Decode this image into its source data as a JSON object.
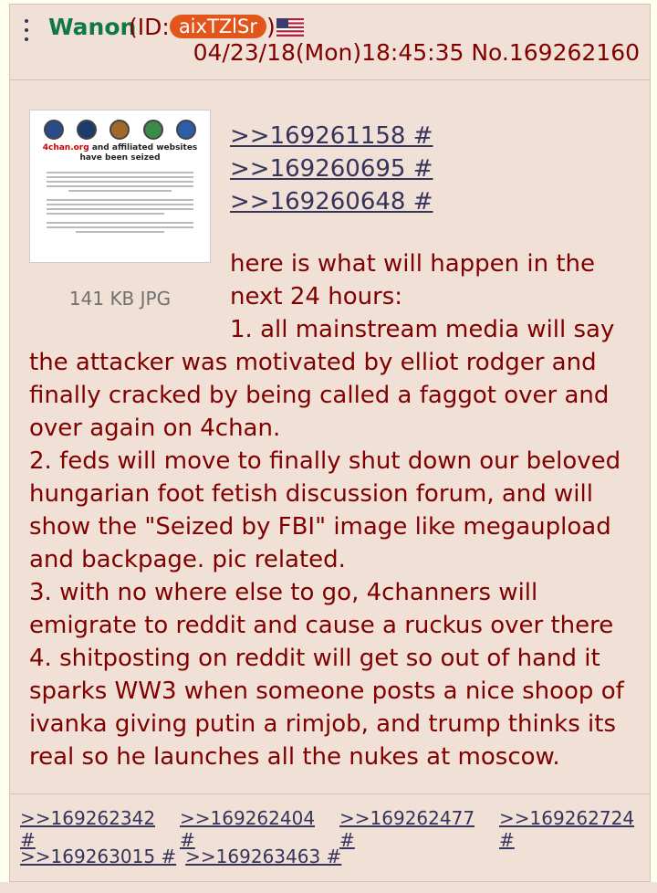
{
  "post": {
    "name": "Wanon",
    "id_prefix": "(ID:",
    "id": "aixTZlSr",
    "id_suffix": ")",
    "flag": "us-flag-icon",
    "datetime": "04/23/18(Mon)18:45:35",
    "number": "No.169262160"
  },
  "file": {
    "size_type": "141 KB JPG",
    "thumb_title_red": "4chan.org",
    "thumb_title_rest": " and affiliated websites have been seized"
  },
  "quote_links": [
    ">>169261158 #",
    ">>169260695 #",
    ">>169260648 #"
  ],
  "body": {
    "lines": [
      "here is what will happen in the next 24 hours:",
      "1. all mainstream media will say the attacker was motivated by elliot rodger and finally cracked by being called a faggot over and over again on 4chan.",
      "2. feds will move to finally shut down our beloved hungarian foot fetish discussion forum, and will show the \"Seized by FBI\" image like megaupload and backpage. pic related.",
      "3. with no where else to go, 4channers will emigrate to reddit and cause a ruckus over there",
      "4. shitposting on reddit will get so out of hand it sparks WW3 when someone posts a nice shoop of ivanka giving putin a rimjob, and trump thinks its real so he launches all the nukes at moscow."
    ]
  },
  "replies": {
    "row1": [
      ">>169262342 #",
      ">>169262404 #",
      ">>169262477 #",
      ">>169262724 #"
    ],
    "row2": [
      ">>169263015 #",
      ">>169263463 #"
    ]
  },
  "colors": {
    "name": "#117743",
    "text": "#800000",
    "link": "#34345C",
    "id_badge": "#E2561B",
    "post_bg": "#F0E0D6"
  }
}
